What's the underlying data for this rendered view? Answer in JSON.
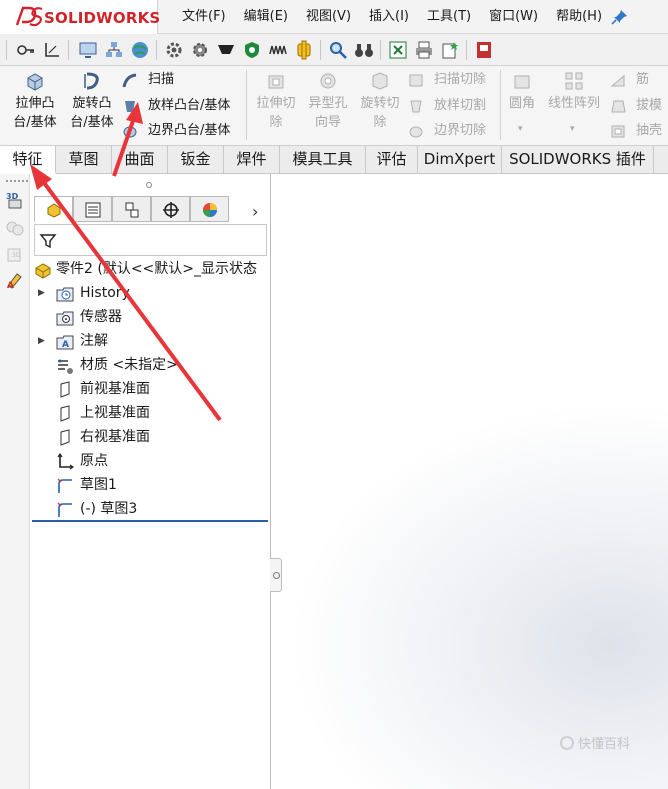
{
  "app": {
    "logo_text": "SOLIDWORKS"
  },
  "menu": [
    {
      "label": "文件(F)"
    },
    {
      "label": "编辑(E)"
    },
    {
      "label": "视图(V)"
    },
    {
      "label": "插入(I)"
    },
    {
      "label": "工具(T)"
    },
    {
      "label": "窗口(W)"
    },
    {
      "label": "帮助(H)"
    }
  ],
  "ribbon": {
    "extrude_boss": "拉伸凸\n台/基体",
    "revolve_boss": "旋转凸\n台/基体",
    "sweep": "扫描",
    "loft_boss": "放样凸台/基体",
    "boundary_boss": "边界凸台/基体",
    "extrude_cut": "拉伸切\n除",
    "hole_wizard": "异型孔\n向导",
    "revolve_cut": "旋转切\n除",
    "swept_cut": "扫描切除",
    "lofted_cut": "放样切割",
    "boundary_cut": "边界切除",
    "fillet": "圆角",
    "linear_pattern": "线性阵列",
    "rib": "筋",
    "draft": "拔模",
    "shell": "抽壳"
  },
  "tabs": [
    {
      "label": "特征",
      "active": true
    },
    {
      "label": "草图"
    },
    {
      "label": "曲面"
    },
    {
      "label": "钣金"
    },
    {
      "label": "焊件"
    },
    {
      "label": "模具工具"
    },
    {
      "label": "评估"
    },
    {
      "label": "DimXpert"
    },
    {
      "label": "SOLIDWORKS 插件"
    }
  ],
  "tree": {
    "root": "零件2 (默认<<默认>_显示状态",
    "items": [
      {
        "label": "History",
        "expandable": true,
        "icon": "history-folder-icon"
      },
      {
        "label": "传感器",
        "expandable": false,
        "icon": "sensor-folder-icon"
      },
      {
        "label": "注解",
        "expandable": true,
        "icon": "annotation-folder-icon"
      },
      {
        "label": "材质 <未指定>",
        "expandable": false,
        "icon": "material-icon"
      },
      {
        "label": "前视基准面",
        "expandable": false,
        "icon": "plane-icon"
      },
      {
        "label": "上视基准面",
        "expandable": false,
        "icon": "plane-icon"
      },
      {
        "label": "右视基准面",
        "expandable": false,
        "icon": "plane-icon"
      },
      {
        "label": "原点",
        "expandable": false,
        "icon": "origin-icon"
      },
      {
        "label": "草图1",
        "expandable": false,
        "icon": "sketch-icon"
      },
      {
        "label": "(-) 草图3",
        "expandable": false,
        "icon": "sketch-icon"
      }
    ]
  },
  "watermark": {
    "text": "快懂百科"
  },
  "colors": {
    "brand_red": "#d3222a",
    "annotation_arrow": "#e8353a",
    "tree_end_bar": "#2a5fa8"
  }
}
